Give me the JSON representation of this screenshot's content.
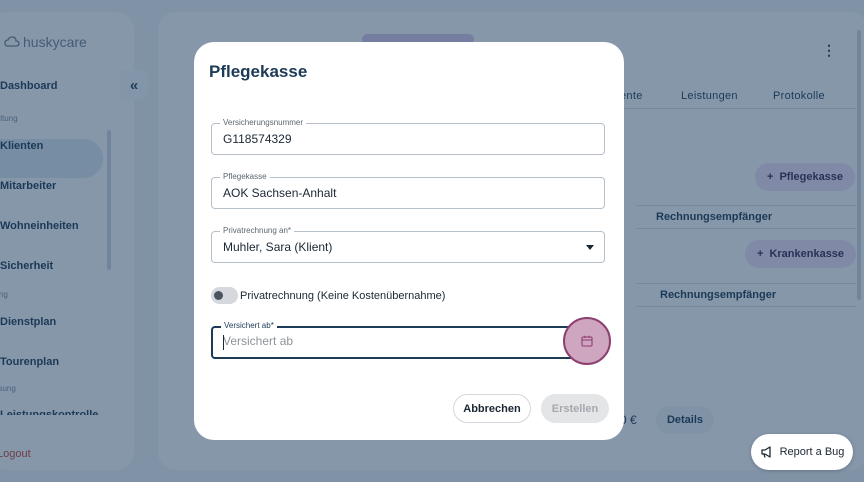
{
  "app": {
    "logo_text": "huskycare",
    "logout_label": "Logout"
  },
  "sidebar": {
    "items": [
      {
        "label": "Dashboard"
      },
      {
        "label": "Klienten"
      },
      {
        "label": "Mitarbeiter"
      },
      {
        "label": "Wohneinheiten"
      },
      {
        "label": "Sicherheit"
      },
      {
        "label": "Dienstplan"
      },
      {
        "label": "Tourenplan"
      },
      {
        "label": "Leistungskontrolle"
      }
    ],
    "sections": [
      "waltung",
      "nung",
      "assung"
    ],
    "collapse_icon": "double-chevron-left-icon"
  },
  "main": {
    "tabs": [
      "ente",
      "Leistungen",
      "Protokolle"
    ],
    "pflegekasse_button": "Pflegekasse",
    "krankenkasse_button": "Krankenkasse",
    "table_header_1": "Rechnungsempfänger",
    "table_header_2": "Rechnungsempfänger",
    "amount_suffix": "0 €",
    "details_button": "Details"
  },
  "modal": {
    "title": "Pflegekasse",
    "fields": {
      "versicherungsnummer": {
        "label": "Versicherungsnummer",
        "value": "G118574329"
      },
      "pflegekasse": {
        "label": "Pflegekasse",
        "value": "AOK Sachsen-Anhalt"
      },
      "privatrechnung_an": {
        "label": "Privatrechnung an*",
        "value": "Muhler, Sara (Klient)"
      },
      "versichert_ab": {
        "label": "Versichert ab*",
        "placeholder": "Versichert ab"
      }
    },
    "toggle_label": "Privatrechnung (Keine Kostenübernahme)",
    "toggle_on": false,
    "cancel_button": "Abbrechen",
    "create_button": "Erstellen"
  },
  "report_bug": {
    "label": "Report a Bug"
  },
  "colors": {
    "primary": "#1d3a56",
    "highlight_ring": "#8d3f70",
    "accent_purple": "#e8ddf3"
  }
}
